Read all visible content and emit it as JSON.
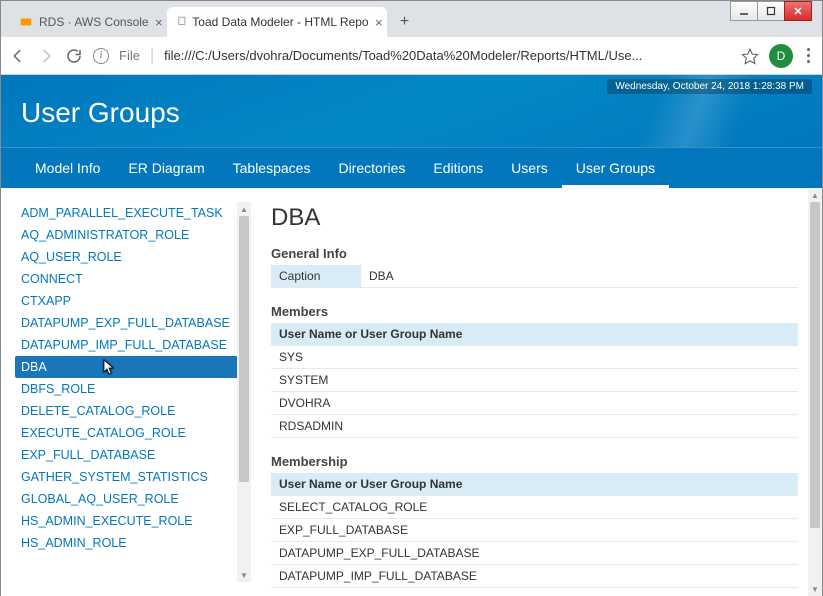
{
  "window": {
    "tabs": [
      {
        "title": "RDS · AWS Console",
        "favicon": "aws"
      },
      {
        "title": "Toad Data Modeler - HTML Repo",
        "favicon": "doc"
      }
    ],
    "newtab_label": "+"
  },
  "address": {
    "prefix": "File",
    "url": "file:///C:/Users/dvohra/Documents/Toad%20Data%20Modeler/Reports/HTML/Use...",
    "avatar_letter": "D"
  },
  "header": {
    "title": "User Groups",
    "timestamp": "Wednesday, October 24, 2018 1:28:38 PM"
  },
  "navtabs": [
    "Model Info",
    "ER Diagram",
    "Tablespaces",
    "Directories",
    "Editions",
    "Users",
    "User Groups"
  ],
  "navtabs_active_index": 6,
  "sidebar": {
    "items": [
      "ADM_PARALLEL_EXECUTE_TASK",
      "AQ_ADMINISTRATOR_ROLE",
      "AQ_USER_ROLE",
      "CONNECT",
      "CTXAPP",
      "DATAPUMP_EXP_FULL_DATABASE",
      "DATAPUMP_IMP_FULL_DATABASE",
      "DBA",
      "DBFS_ROLE",
      "DELETE_CATALOG_ROLE",
      "EXECUTE_CATALOG_ROLE",
      "EXP_FULL_DATABASE",
      "GATHER_SYSTEM_STATISTICS",
      "GLOBAL_AQ_USER_ROLE",
      "HS_ADMIN_EXECUTE_ROLE",
      "HS_ADMIN_ROLE"
    ],
    "selected_index": 7
  },
  "detail": {
    "title": "DBA",
    "general_info": {
      "section_label": "General Info",
      "caption_label": "Caption",
      "caption_value": "DBA"
    },
    "members": {
      "section_label": "Members",
      "header": "User Name or User Group Name",
      "rows": [
        "SYS",
        "SYSTEM",
        "DVOHRA",
        "RDSADMIN"
      ]
    },
    "membership": {
      "section_label": "Membership",
      "header": "User Name or User Group Name",
      "rows": [
        "SELECT_CATALOG_ROLE",
        "EXP_FULL_DATABASE",
        "DATAPUMP_EXP_FULL_DATABASE",
        "DATAPUMP_IMP_FULL_DATABASE"
      ]
    }
  }
}
